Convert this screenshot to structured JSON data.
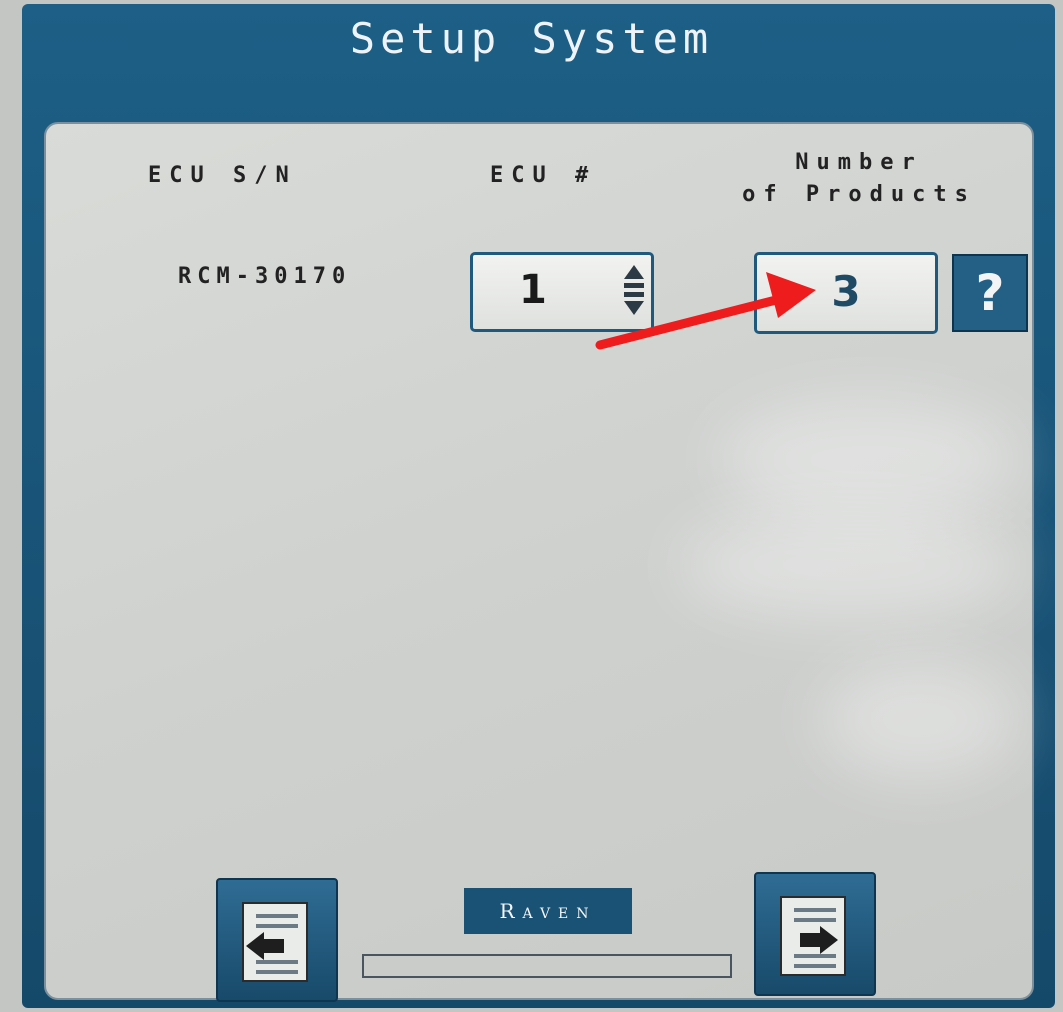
{
  "header": {
    "title": "Setup System"
  },
  "columns": {
    "ecu_sn_label": "ECU S/N",
    "ecu_num_label": "ECU #",
    "products_label": "Number\nof Products"
  },
  "row": {
    "serial": "RCM-30170",
    "ecu_number": "1",
    "number_of_products": "3"
  },
  "help": {
    "label": "?"
  },
  "footer": {
    "logo_text": "Raven",
    "progress": 0
  },
  "icons": {
    "stepper": "up-down-stepper-icon",
    "back": "page-back-icon",
    "next": "page-next-icon",
    "annotation": "red-arrow-icon"
  },
  "colors": {
    "bezel": "#1d5f86",
    "panel": "#d4d6d3",
    "annotation_arrow": "#ee1c1c"
  }
}
